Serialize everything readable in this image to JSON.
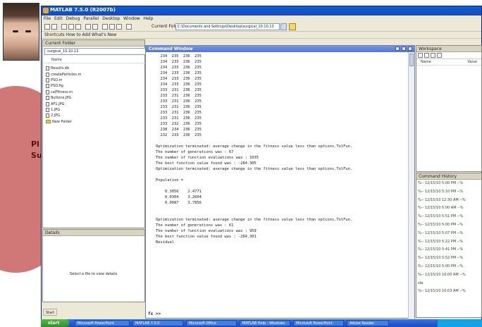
{
  "app": {
    "title": "MATLAB 7.5.0 (R2007b)"
  },
  "menu": [
    "File",
    "Edit",
    "Debug",
    "Parallel",
    "Desktop",
    "Window",
    "Help"
  ],
  "toolbar": {
    "current_directory_label": "Current Folder:",
    "current_directory_value": "C:\\Documents and Settings\\Desktop\\surgical_10.10.13"
  },
  "shortcuts": "Shortcuts  How to Add  What's New",
  "current_folder": {
    "title": "Current Folder",
    "path": "surgical_10.10.13",
    "column_name": "Name",
    "files": [
      {
        "name": "Results.db",
        "type": "file"
      },
      {
        "name": "createParticles.m",
        "type": "file"
      },
      {
        "name": "PSO.m",
        "type": "file"
      },
      {
        "name": "PSO.fig",
        "type": "file"
      },
      {
        "name": "calFitness.m",
        "type": "file"
      },
      {
        "name": "Buttons.JPG",
        "type": "file"
      },
      {
        "name": "AF1.JPG",
        "type": "file"
      },
      {
        "name": "1.JPG",
        "type": "file"
      },
      {
        "name": "2.JPG",
        "type": "file"
      },
      {
        "name": "New Folder",
        "type": "folder"
      }
    ]
  },
  "details": {
    "title": "Details",
    "message": "Select a file to view details"
  },
  "command_window": {
    "title": "Command Window",
    "lines": [
      "  234  235  236  235",
      "  234  233  236  235",
      "  234  233  236  235",
      "  234  233  236  235",
      "  234  233  236  235",
      "  234  233  236  235",
      "  233  231  236  235",
      "  233  231  236  235",
      "  233  231  236  235",
      "  233  231  236  235",
      "  233  231  236  235",
      "  233  231  236  235",
      "  233  232  236  235",
      "  238  234  236  235",
      "  232  233  236  235",
      "",
      "Optimization terminated: average change in the fitness value less than options.TolFun.",
      "The number of generations was : 67",
      "The number of function evaluations was : 1035",
      "The best function value found was : -284.305",
      "Optimization terminated: average change in the fitness value less than options.TolFun.",
      "",
      "Population =",
      "",
      "    0.3856    2.4771",
      "    0.0304    3.2604",
      "    0.0087    3.7856",
      "",
      "",
      "Optimization terminated: average change in the fitness value less than options.TolFun.",
      "The number of generations was : 61",
      "The number of function evaluations was : 959",
      "The best function value found was : -284.301",
      "Residual"
    ],
    "prompt": "fx >>"
  },
  "workspace": {
    "title": "Workspace",
    "col_name": "Name",
    "col_value": "Value"
  },
  "history": {
    "title": "Command History",
    "rows": [
      "%-- 12/15/10  5:00 PM --%",
      "%-- 12/15/10  5:10 PM --%",
      "%-- 12/15/10 12:30 AM --%",
      "%-- 12/15/10  5:00 AM --%",
      "%-- 12/15/10  5:51 PM --%",
      "%-- 12/15/10  5:00 PM --%",
      "%-- 12/15/10  5:07 PM --%",
      "%-- 12/15/10  5:22 PM --%",
      "%-- 12/15/10  5:41 PM --%",
      "%-- 12/15/10  5:52 PM --%",
      "%-- 12/15/10  5:00 PM --%",
      "%-- 12/15/10 10:00 AM --%",
      "  cla",
      "%-- 12/15/10 10:03 AM --%"
    ]
  },
  "start_tab": "Start",
  "slide": {
    "line1": "Pl",
    "line2": "Su"
  },
  "taskbar": {
    "start": "start",
    "items": [
      "Microsoft PowerPoint",
      "MATLAB 7.5.0",
      "Microsoft Office",
      "MATLAB Help - Windows",
      "Microsoft PowerPoint",
      "Adobe Reader"
    ]
  }
}
